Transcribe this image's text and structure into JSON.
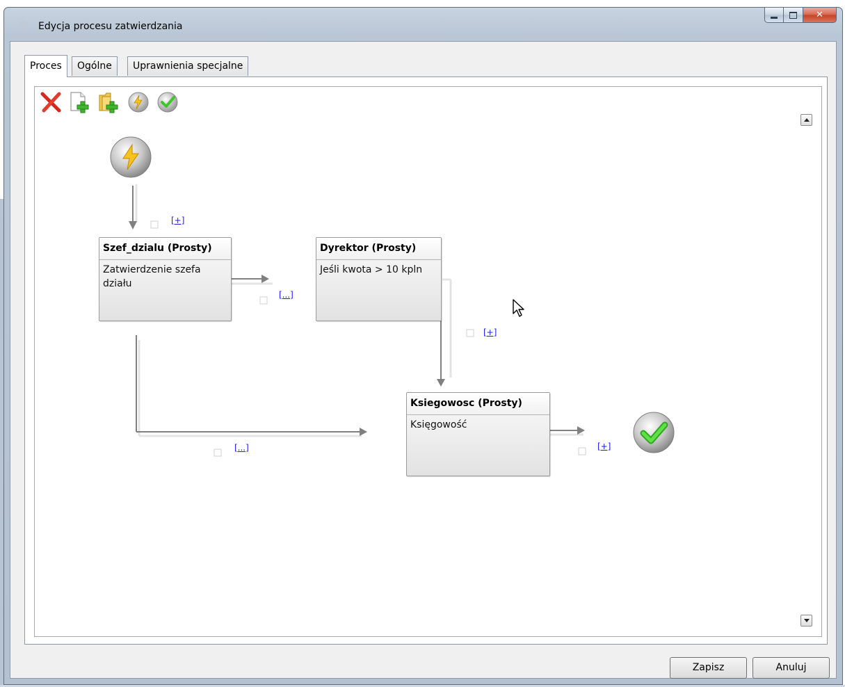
{
  "window": {
    "title": "Edycja procesu zatwierdzania"
  },
  "tabs": [
    {
      "label": "Proces",
      "active": true
    },
    {
      "label": "Ogólne",
      "active": false
    },
    {
      "label": "Uprawnienia specjalne",
      "active": false
    }
  ],
  "toolbar": {
    "icons": [
      "delete-icon",
      "new-document-icon",
      "new-folder-icon",
      "start-event-icon",
      "end-event-icon"
    ]
  },
  "nodes": [
    {
      "id": "szef",
      "title": "Szef_dzialu (Prosty)",
      "desc": "Zatwierdzenie szefa działu"
    },
    {
      "id": "dyrektor",
      "title": "Dyrektor (Prosty)",
      "desc": "Jeśli kwota > 10 kpln"
    },
    {
      "id": "ksiegowosc",
      "title": "Ksiegowosc (Prosty)",
      "desc": "Księgowość"
    }
  ],
  "edges": [
    {
      "from": "start",
      "to": "szef",
      "label": "[+]"
    },
    {
      "from": "szef",
      "to": "dyrektor",
      "label": "[...]"
    },
    {
      "from": "dyrektor",
      "to": "ksiegowosc",
      "label": "[+]"
    },
    {
      "from": "szef",
      "to": "ksiegowosc",
      "label": "[...]"
    },
    {
      "from": "ksiegowosc",
      "to": "end",
      "label": "[+]"
    }
  ],
  "footer": {
    "save_label": "Zapisz",
    "cancel_label": "Anuluj"
  },
  "colors": {
    "link": "#1a1aff",
    "arrow": "#808080",
    "check_green": "#3fc62a",
    "bolt_yellow": "#f7c21a"
  }
}
